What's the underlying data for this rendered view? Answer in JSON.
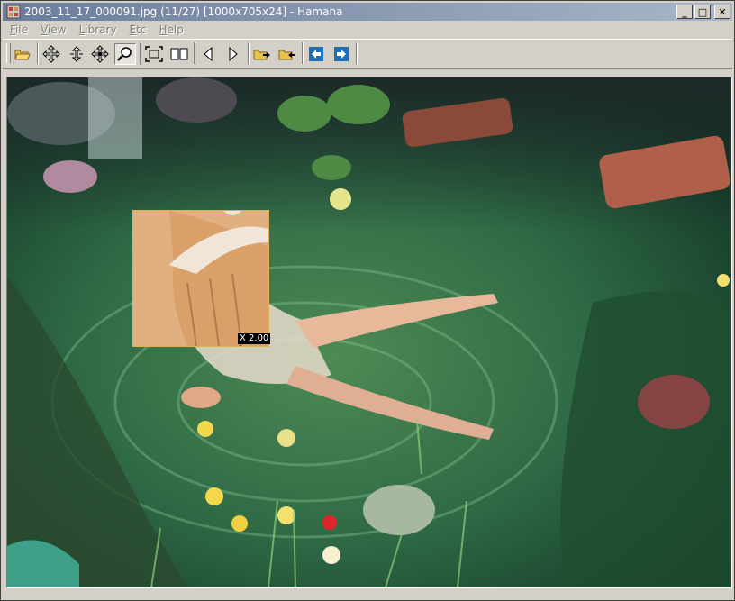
{
  "window": {
    "title": "2003_11_17_000091.jpg (11/27) [1000x705x24] - Hamana",
    "controls": {
      "minimize": "_",
      "maximize": "□",
      "close": "✕"
    }
  },
  "menu": [
    "File",
    "View",
    "Library",
    "Etc",
    "Help"
  ],
  "toolbar": {
    "buttons": [
      "open-folder-icon",
      "pan-icon",
      "rotate-cw-icon",
      "rotate-ccw-icon",
      "magnifier-icon",
      "fit-screen-icon",
      "two-page-icon",
      "previous-icon",
      "next-icon",
      "previous-folder-icon",
      "next-folder-icon",
      "first-image-icon",
      "last-image-icon"
    ],
    "active": "magnifier-icon"
  },
  "viewer": {
    "zoom_label": "X 2.00"
  },
  "colors": {
    "title_gradient_start": "#6b7d9c",
    "title_gradient_end": "#a9b6c9",
    "chrome": "#d4d0c8",
    "magnifier_border": "#e0b050",
    "nav_arrow_blue": "#1d6fb8"
  }
}
